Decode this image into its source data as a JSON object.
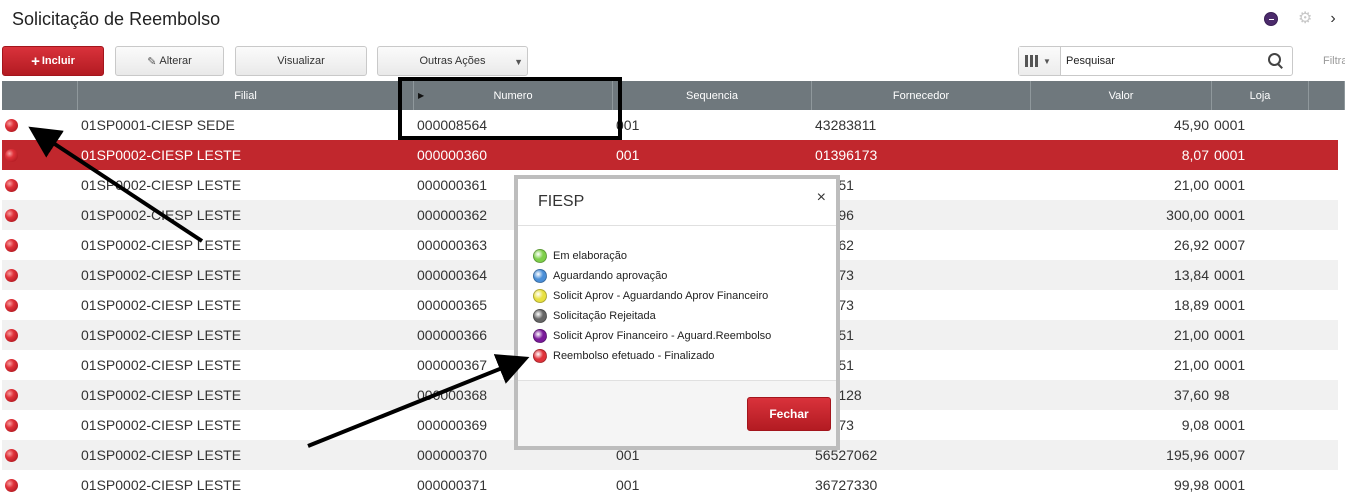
{
  "header": {
    "title": "Solicitação de Reembolso"
  },
  "toolbar": {
    "incluir": "Incluir",
    "alterar": "Alterar",
    "visualizar": "Visualizar",
    "outras_acoes": "Outras Ações",
    "search_value": "Pesquisar",
    "filtra_label": "Filtra"
  },
  "columns": [
    "",
    "Filial",
    "Numero",
    "Sequencia",
    "Fornecedor",
    "Valor",
    "Loja"
  ],
  "rows": [
    {
      "filial": "01SP0001-CIESP SEDE",
      "numero": "000008564",
      "sequencia": "001",
      "fornecedor": "43283811",
      "valor": "45,90",
      "loja": "0001"
    },
    {
      "filial": "01SP0002-CIESP LESTE",
      "numero": "000000360",
      "sequencia": "001",
      "fornecedor": "01396173",
      "valor": "8,07",
      "loja": "0001"
    },
    {
      "filial": "01SP0002-CIESP LESTE",
      "numero": "000000361",
      "sequencia": "",
      "fornecedor": "23251",
      "valor": "21,00",
      "loja": "0001"
    },
    {
      "filial": "01SP0002-CIESP LESTE",
      "numero": "000000362",
      "sequencia": "",
      "fornecedor": "37096",
      "valor": "300,00",
      "loja": "0001"
    },
    {
      "filial": "01SP0002-CIESP LESTE",
      "numero": "000000363",
      "sequencia": "",
      "fornecedor": "27062",
      "valor": "26,92",
      "loja": "0007"
    },
    {
      "filial": "01SP0002-CIESP LESTE",
      "numero": "000000364",
      "sequencia": "",
      "fornecedor": "96173",
      "valor": "13,84",
      "loja": "0001"
    },
    {
      "filial": "01SP0002-CIESP LESTE",
      "numero": "000000365",
      "sequencia": "",
      "fornecedor": "96173",
      "valor": "18,89",
      "loja": "0001"
    },
    {
      "filial": "01SP0002-CIESP LESTE",
      "numero": "000000366",
      "sequencia": "",
      "fornecedor": "23251",
      "valor": "21,00",
      "loja": "0001"
    },
    {
      "filial": "01SP0002-CIESP LESTE",
      "numero": "000000367",
      "sequencia": "",
      "fornecedor": "23251",
      "valor": "21,00",
      "loja": "0001"
    },
    {
      "filial": "01SP0002-CIESP LESTE",
      "numero": "000000368",
      "sequencia": "",
      "fornecedor": "353128",
      "valor": "37,60",
      "loja": "98"
    },
    {
      "filial": "01SP0002-CIESP LESTE",
      "numero": "000000369",
      "sequencia": "",
      "fornecedor": "96173",
      "valor": "9,08",
      "loja": "0001"
    },
    {
      "filial": "01SP0002-CIESP LESTE",
      "numero": "000000370",
      "sequencia": "001",
      "fornecedor": "56527062",
      "valor": "195,96",
      "loja": "0007"
    },
    {
      "filial": "01SP0002-CIESP LESTE",
      "numero": "000000371",
      "sequencia": "001",
      "fornecedor": "36727330",
      "valor": "99,98",
      "loja": "0001"
    }
  ],
  "modal": {
    "title": "FIESP",
    "close_glyph": "×",
    "legend": [
      {
        "label": "Em elaboração",
        "color": "#7ed04a"
      },
      {
        "label": "Aguardando aprovação",
        "color": "#4a8fd8"
      },
      {
        "label": "Solicit Aprov - Aguardando Aprov Financeiro",
        "color": "#e8e040"
      },
      {
        "label": "Solicitação Rejeitada",
        "color": "#666666"
      },
      {
        "label": "Solicit Aprov Financeiro - Aguard.Reembolso",
        "color": "#7a1a9a"
      },
      {
        "label": "Reembolso efetuado - Finalizado",
        "color": "#e0323a"
      }
    ],
    "fechar": "Fechar"
  },
  "colors": {
    "accent": "#c1272d",
    "header_bg": "#6f787d"
  }
}
